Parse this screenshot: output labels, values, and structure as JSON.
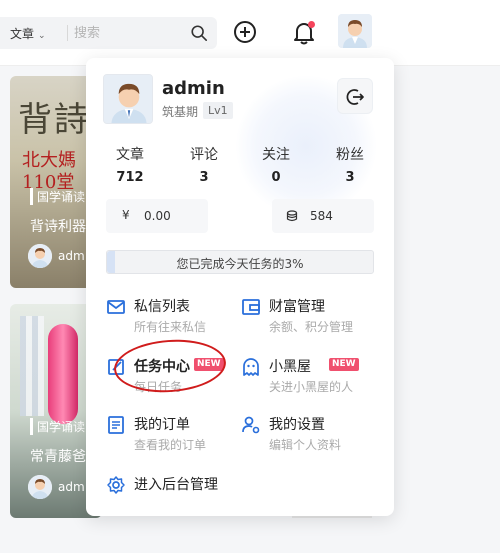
{
  "header": {
    "search_type": "文章",
    "search_placeholder": "搜索"
  },
  "cards": [
    {
      "big_text": "背詩",
      "red_text": "北大媽\n110堂",
      "tag": "国学诵读",
      "title": "背诗利器",
      "author": "adm"
    },
    {
      "tag": "国学诵读",
      "title": "常青藤爸",
      "author": "adm"
    }
  ],
  "user": {
    "name": "admin",
    "rank": "筑基期",
    "level": "Lv1"
  },
  "stats": [
    {
      "label": "文章",
      "value": "712"
    },
    {
      "label": "评论",
      "value": "3"
    },
    {
      "label": "关注",
      "value": "0"
    },
    {
      "label": "粉丝",
      "value": "3"
    }
  ],
  "balance": {
    "currency_icon": "¥",
    "amount": "0.00"
  },
  "coins": {
    "amount": "584"
  },
  "task": {
    "text": "您已完成今天任务的3%",
    "progress": 0.03
  },
  "menu": [
    {
      "title": "私信列表",
      "subtitle": "所有往来私信"
    },
    {
      "title": "财富管理",
      "subtitle": "余额、积分管理"
    },
    {
      "title": "任务中心",
      "subtitle": "每日任务",
      "badge": "NEW"
    },
    {
      "title": "小黑屋",
      "subtitle": "关进小黑屋的人",
      "badge": "NEW"
    },
    {
      "title": "我的订单",
      "subtitle": "查看我的订单"
    },
    {
      "title": "我的设置",
      "subtitle": "编辑个人资料"
    },
    {
      "title": "进入后台管理"
    }
  ],
  "colors": {
    "accent": "#2a6fdb",
    "badge": "#f0506e",
    "annotation": "#d01c1c"
  }
}
